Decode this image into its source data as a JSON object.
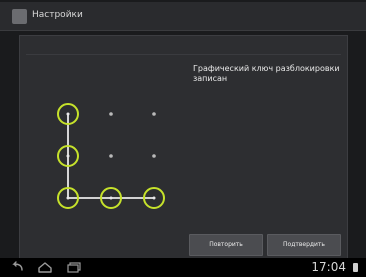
{
  "window": {
    "title": "Настройки"
  },
  "panel": {
    "header": "",
    "message_line1": "Графический ключ разблокировки",
    "message_line2": "записан"
  },
  "buttons": {
    "retry_label": "Повторить",
    "confirm_label": "Подтвердить"
  },
  "status": {
    "time": "17:04"
  },
  "colors": {
    "accent": "#c6e22b",
    "background": "#1a1b1d",
    "panel": "#2d2e31",
    "text": "#eaeaea"
  },
  "icons": [
    "settings-app-icon",
    "back-icon",
    "home-icon",
    "recent-apps-icon",
    "battery-icon"
  ]
}
